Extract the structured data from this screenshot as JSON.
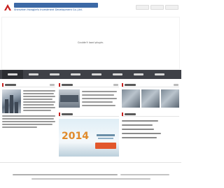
{
  "header": {
    "company_name_cn": "",
    "company_name_en": "Shenzhen Hongjiefu Investment Development Co.,Ltd.",
    "top_links": [
      "",
      "",
      ""
    ],
    "logo_color": "#c8201d"
  },
  "banner": {
    "plugin_message": "Couldn't load plugin."
  },
  "nav": {
    "items": [
      "",
      "",
      "",
      "",
      "",
      "",
      "",
      ""
    ],
    "bar_color": "#3f4147"
  },
  "panels": {
    "intro": {
      "title": ""
    },
    "news": {
      "title": ""
    },
    "products": {
      "title": ""
    },
    "project": {
      "title": "",
      "ad_year": "2014"
    },
    "contact": {
      "title": ""
    }
  },
  "footer": {
    "copyright": "",
    "powered_by": ""
  },
  "colors": {
    "brand_blue": "#1a4f96",
    "accent_red": "#c8201d",
    "ad_orange": "#e08a2a"
  }
}
